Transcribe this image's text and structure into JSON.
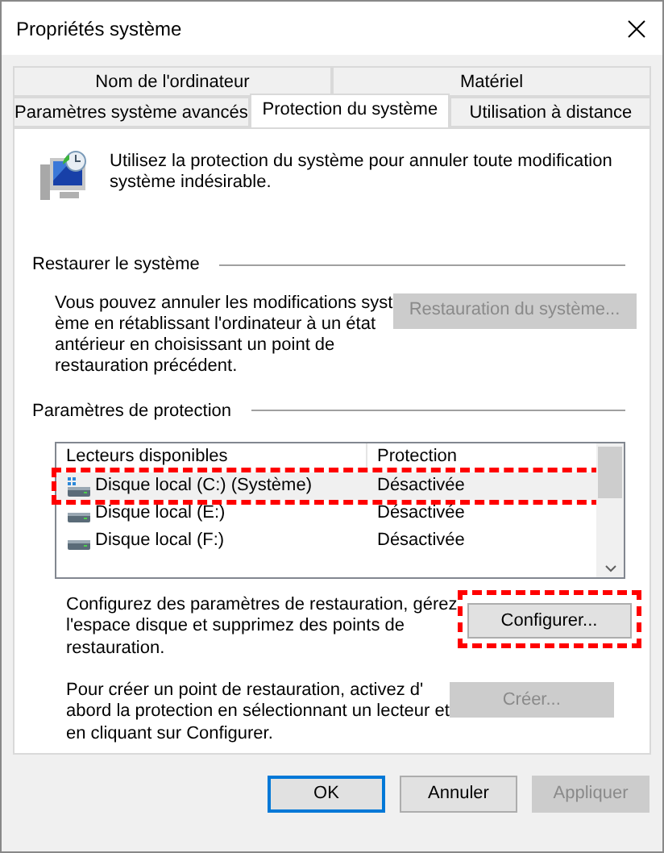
{
  "window": {
    "title": "Propriétés système"
  },
  "tab_rows": [
    [
      {
        "label": "Nom de l'ordinateur",
        "selected": false
      },
      {
        "label": "Matériel",
        "selected": false
      }
    ],
    [
      {
        "label": "Paramètres système avancés",
        "selected": false
      },
      {
        "label": "Protection du système",
        "selected": true
      },
      {
        "label": "Utilisation à distance",
        "selected": false
      }
    ]
  ],
  "intro": [
    "Utilisez la protection du système pour annuler toute modification",
    "système indésirable."
  ],
  "restore": {
    "heading": "Restaurer le système",
    "text": [
      "Vous pouvez annuler les modifications syst",
      "ème en rétablissant l'ordinateur à un état",
      "antérieur en choisissant un point de",
      "restauration précédent."
    ],
    "button": {
      "label": "Restauration du système...",
      "disabled": true
    }
  },
  "protection": {
    "heading": "Paramètres de protection",
    "columns": [
      "Lecteurs disponibles",
      "Protection"
    ],
    "drives": [
      {
        "kind": "system",
        "name": "Disque local (C:) (Système)",
        "protection": "Désactivée",
        "selected": true,
        "highlighted": true
      },
      {
        "kind": "drive",
        "name": "Disque local (E:)",
        "protection": "Désactivée",
        "selected": false,
        "highlighted": false
      },
      {
        "kind": "drive",
        "name": "Disque local (F:)",
        "protection": "Désactivée",
        "selected": false,
        "highlighted": false
      }
    ],
    "configure_text": [
      "Configurez des paramètres de restauration, gérez",
      "l'espace disque et supprimez des points de",
      "restauration."
    ],
    "configure_button": {
      "label": "Configurer...",
      "disabled": false,
      "highlighted": true
    },
    "create_text": [
      "Pour créer un point de restauration, activez d'",
      "abord la protection en sélectionnant un lecteur et",
      "en cliquant sur Configurer."
    ],
    "create_button": {
      "label": "Créer...",
      "disabled": true
    }
  },
  "buttons": [
    {
      "label": "OK",
      "disabled": false,
      "default": true
    },
    {
      "label": "Annuler",
      "disabled": false,
      "default": false
    },
    {
      "label": "Appliquer",
      "disabled": true,
      "default": false
    }
  ]
}
